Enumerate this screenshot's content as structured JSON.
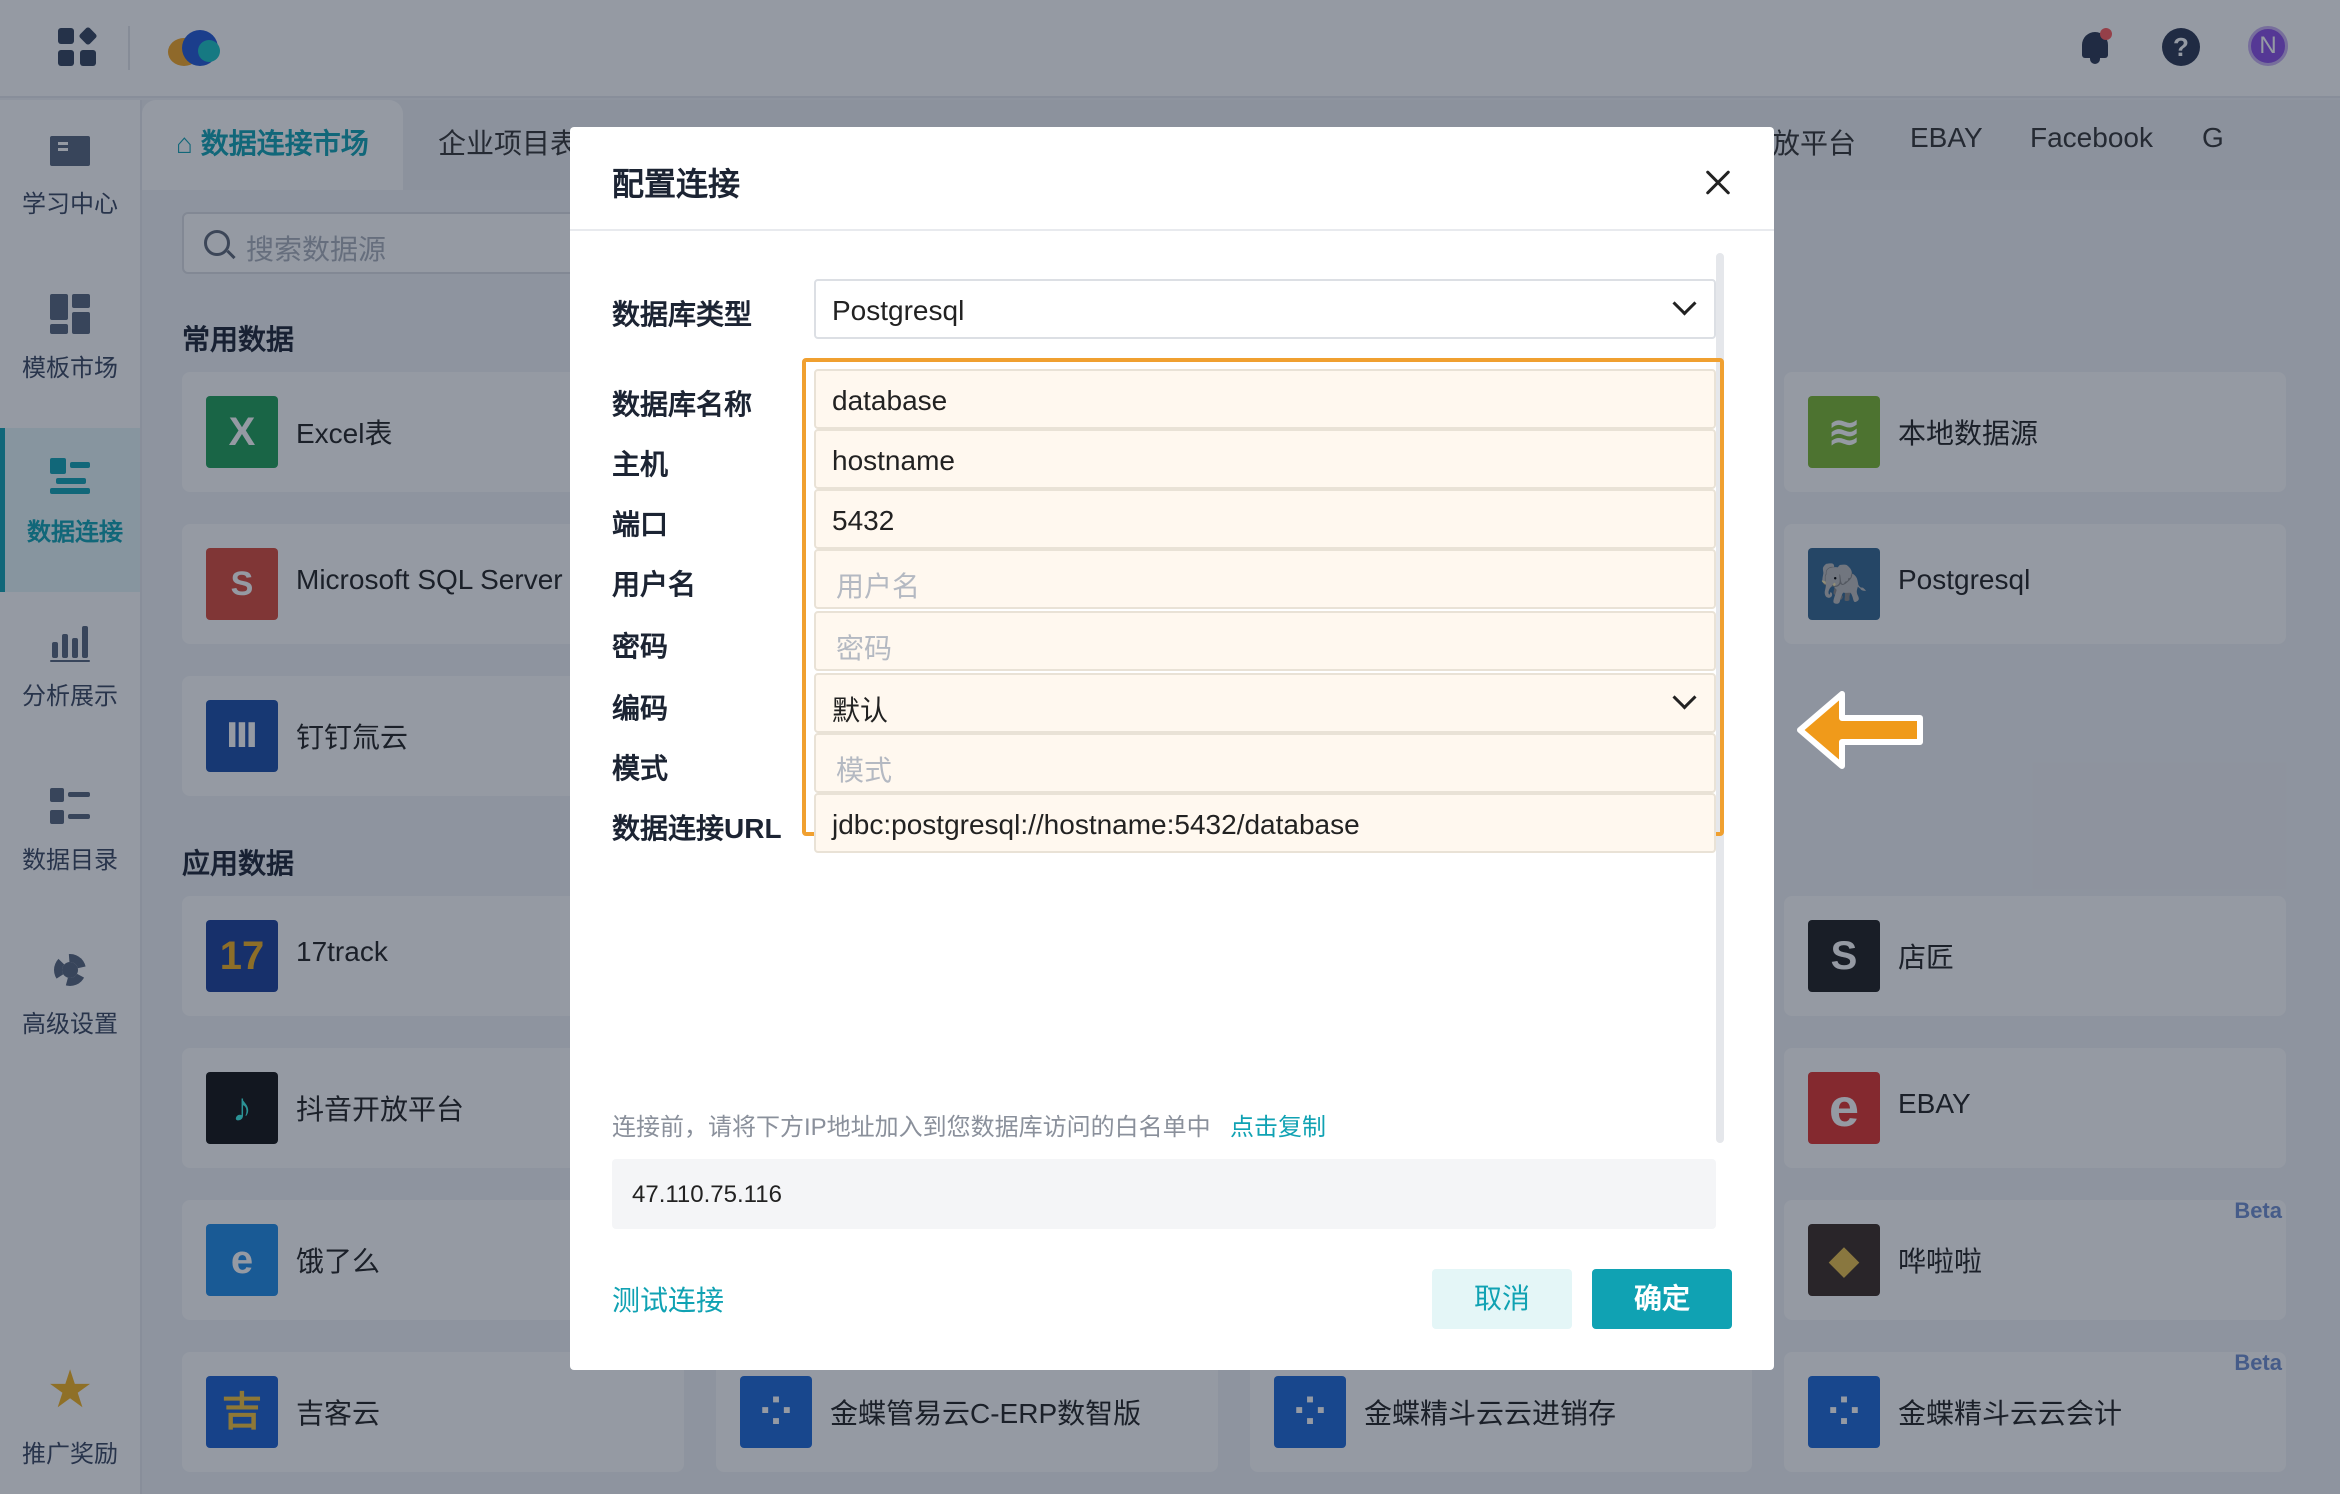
{
  "sidebar": {
    "items": [
      {
        "label": "学习中心"
      },
      {
        "label": "模板市场"
      },
      {
        "label": "数据连接"
      },
      {
        "label": "分析展示"
      },
      {
        "label": "数据目录"
      },
      {
        "label": "高级设置"
      },
      {
        "label": "推广奖励"
      }
    ]
  },
  "tabs": {
    "active": "数据连接市场",
    "items": [
      "企业项目表",
      "放平台",
      "EBAY",
      "Facebook",
      "G"
    ]
  },
  "search": {
    "placeholder": "搜索数据源"
  },
  "sections": {
    "common": "常用数据",
    "app": "应用数据"
  },
  "cards": {
    "excel": "Excel表",
    "sqlserver": "Microsoft SQL Server",
    "dingtalk": "钉钉氚云",
    "local": "本地数据源",
    "postgres": "Postgresql",
    "track17": "17track",
    "douyin": "抖音开放平台",
    "eleme": "饿了么",
    "jikeyun": "吉客云",
    "dianjiang": "店匠",
    "ebay": "EBAY",
    "hualala": "哗啦啦",
    "kingdee_erp": "金蝶管易云C-ERP数智版",
    "kingdee_inv": "金蝶精斗云云进销存",
    "kingdee_acc": "金蝶精斗云云会计",
    "beta": "Beta"
  },
  "dialog": {
    "title": "配置连接",
    "fields": [
      {
        "label": "数据库类型",
        "value": "Postgresql",
        "placeholder": ""
      },
      {
        "label": "数据库名称",
        "value": "database",
        "placeholder": ""
      },
      {
        "label": "主机",
        "value": "hostname",
        "placeholder": ""
      },
      {
        "label": "端口",
        "value": "5432",
        "placeholder": ""
      },
      {
        "label": "用户名",
        "value": "",
        "placeholder": "用户名"
      },
      {
        "label": "密码",
        "value": "",
        "placeholder": "密码"
      },
      {
        "label": "编码",
        "value": "默认",
        "placeholder": ""
      },
      {
        "label": "模式",
        "value": "",
        "placeholder": "模式"
      },
      {
        "label": "数据连接URL",
        "value": "jdbc:postgresql://hostname:5432/database",
        "placeholder": ""
      }
    ],
    "hint": "连接前，请将下方IP地址加入到您数据库访问的白名单中",
    "copy_link": "点击复制",
    "ip": "47.110.75.116",
    "test_link": "测试连接",
    "cancel": "取消",
    "ok": "确定"
  },
  "user": {
    "avatar_letter": "N"
  },
  "help": {
    "glyph": "?"
  },
  "colors": {
    "accent": "#10a2b3",
    "highlight": "#f0a030",
    "arrow": "#f09a1a"
  }
}
